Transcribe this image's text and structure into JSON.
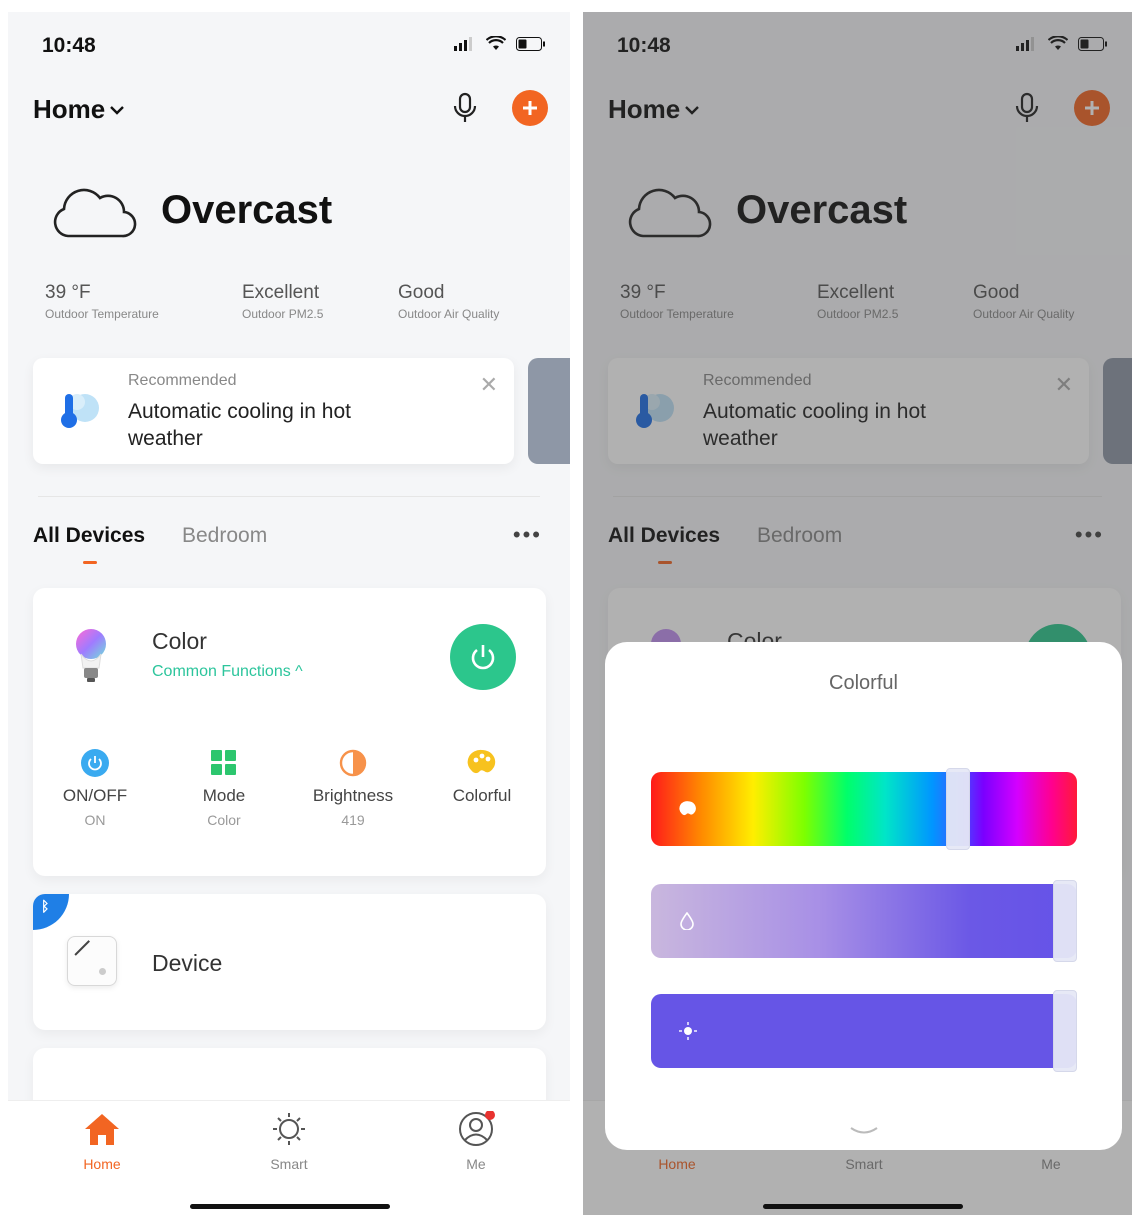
{
  "status": {
    "time": "10:48"
  },
  "header": {
    "home_label": "Home"
  },
  "weather": {
    "condition": "Overcast",
    "stats": [
      {
        "value": "39 °F",
        "label": "Outdoor Temperature"
      },
      {
        "value": "Excellent",
        "label": "Outdoor PM2.5"
      },
      {
        "value": "Good",
        "label": "Outdoor Air Quality"
      }
    ]
  },
  "recommendation": {
    "eyebrow": "Recommended",
    "text": "Automatic cooling in hot weather",
    "close": "✕"
  },
  "tabs": {
    "active": "All Devices",
    "inactive": "Bedroom",
    "more": "•••"
  },
  "color_device": {
    "title": "Color",
    "subtitle": "Common Functions ^",
    "functions": [
      {
        "label": "ON/OFF",
        "value": "ON"
      },
      {
        "label": "Mode",
        "value": "Color"
      },
      {
        "label": "Brightness",
        "value": "419"
      },
      {
        "label": "Colorful",
        "value": ""
      }
    ]
  },
  "device2": {
    "title": "Device"
  },
  "tabbar": {
    "home": "Home",
    "smart": "Smart",
    "me": "Me"
  },
  "sheet": {
    "title": "Colorful",
    "hue_level": 0.72,
    "saturation_level": 1.0,
    "brightness_level": 1.0
  },
  "colors": {
    "accent": "#f26522",
    "power_green": "#2cc68c",
    "link_green": "#2cc59c",
    "bluetooth_blue": "#1f7fe6",
    "slider_purple": "#6655e6"
  }
}
